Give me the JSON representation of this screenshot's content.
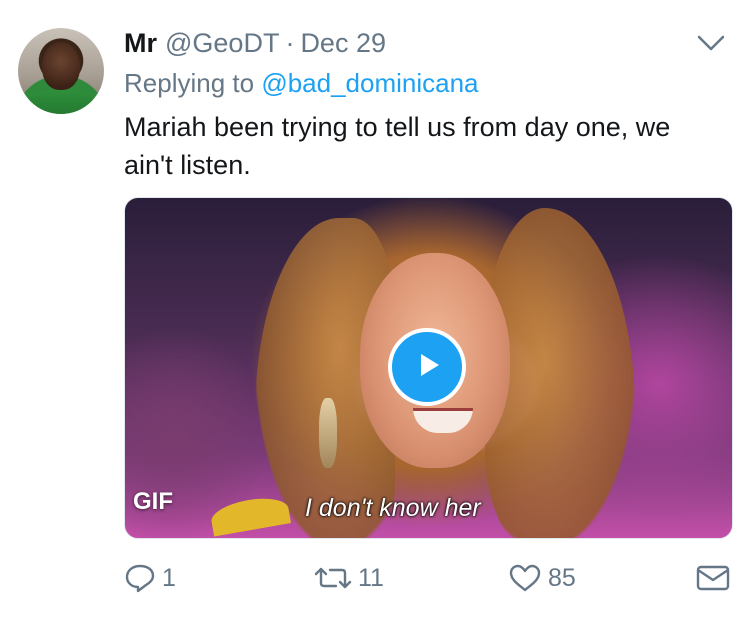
{
  "tweet": {
    "name": "Mr",
    "handle": "@GeoDT",
    "separator": "·",
    "date": "Dec 29",
    "replying_prefix": "Replying to",
    "replying_to": "@bad_dominicana",
    "text": "Mariah been trying to tell us from day one, we ain't listen."
  },
  "media": {
    "badge": "GIF",
    "caption": "I don't know her",
    "icons": {
      "play": "play-icon"
    }
  },
  "actions": {
    "reply_count": "1",
    "retweet_count": "11",
    "like_count": "85"
  },
  "colors": {
    "accent": "#1da1f2",
    "muted": "#657786",
    "text": "#14171a"
  }
}
